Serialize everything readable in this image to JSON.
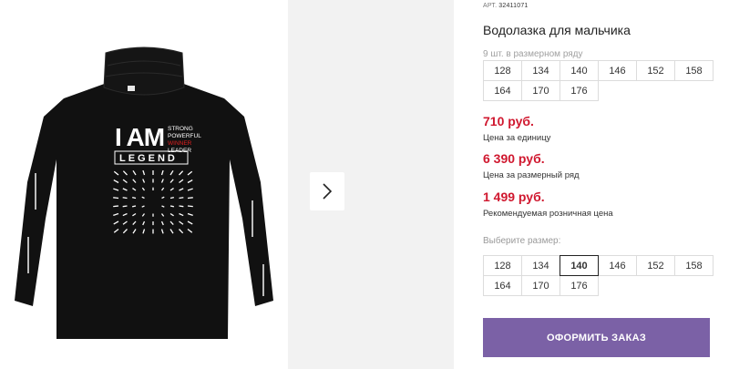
{
  "product": {
    "sku_label": "АРТ.",
    "sku_value": "32411071",
    "title": "Водолазка для мальчика",
    "print_text": {
      "line_main": "I AM",
      "words": [
        "STRONG",
        "POWERFUL",
        "WINNER",
        "LEADER"
      ],
      "line_sub": "LEGEND"
    }
  },
  "size_row": {
    "note": "9 шт. в размерном ряду",
    "sizes": [
      "128",
      "134",
      "140",
      "146",
      "152",
      "158",
      "164",
      "170",
      "176"
    ]
  },
  "prices": [
    {
      "value": "710 руб.",
      "note": "Цена за единицу"
    },
    {
      "value": "6 390 руб.",
      "note": "Цена за размерный ряд"
    },
    {
      "value": "1 499 руб.",
      "note": "Рекомендуемая розничная цена"
    }
  ],
  "size_choice": {
    "label": "Выберите размер:",
    "sizes": [
      "128",
      "134",
      "140",
      "146",
      "152",
      "158",
      "164",
      "170",
      "176"
    ],
    "selected": "140"
  },
  "order_button": {
    "label": "ОФОРМИТЬ ЗАКАЗ"
  },
  "colors": {
    "price": "#d0182f",
    "accent_button": "#7b61a6",
    "gallery_bg": "#f2f2f2"
  },
  "icons": {
    "next": "chevron-right-icon"
  }
}
